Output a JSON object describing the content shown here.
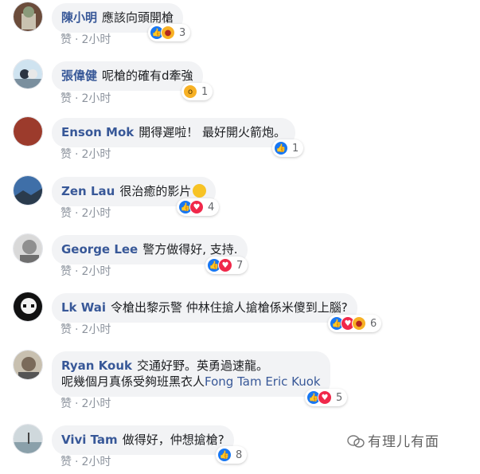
{
  "labels": {
    "like": "赞",
    "dot": "·"
  },
  "comments": [
    {
      "author": "陳小明",
      "text": "應該向頭開槍",
      "time": "2小时",
      "reactions": [
        "like",
        "angry"
      ],
      "count": "3"
    },
    {
      "author": "張偉健",
      "text": "呢槍的確有d牽強",
      "time": "2小时",
      "reactions": [
        "wow"
      ],
      "count": "1"
    },
    {
      "author": "Enson Mok",
      "text": "開得遲啦！ 最好開火箭炮。",
      "time": "2小时",
      "reactions": [
        "like"
      ],
      "count": "1"
    },
    {
      "author": "Zen Lau",
      "text": "很治癒的影片",
      "time": "2小时",
      "reactions": [
        "like",
        "love"
      ],
      "count": "4"
    },
    {
      "author": "George Lee",
      "text": "警方做得好, 支持.",
      "time": "2小时",
      "reactions": [
        "like",
        "love"
      ],
      "count": "7"
    },
    {
      "author": "Lk Wai",
      "text": "令槍出黎示警 仲林住搶人搶槍係米傻到上腦?",
      "time": "2小时",
      "reactions": [
        "like",
        "love",
        "angry"
      ],
      "count": "6"
    },
    {
      "author": "Ryan Kouk",
      "text": "交通好野。英勇過速龍。",
      "text2": "呢幾個月真係受夠班黑衣人",
      "link": "Fong Tam Eric Kuok",
      "time": "2小时",
      "reactions": [
        "like",
        "love"
      ],
      "count": "5"
    },
    {
      "author": "Vivi Tam",
      "text": "做得好，仲想搶槍?",
      "time": "2小时",
      "reactions": [
        "like"
      ],
      "count": "8"
    }
  ],
  "watermark": "有理儿有面"
}
